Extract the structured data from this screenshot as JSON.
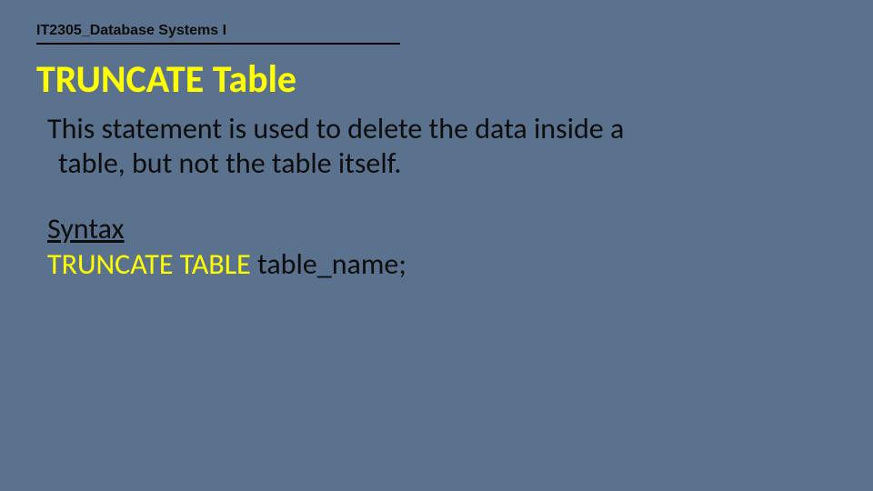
{
  "course": "IT2305_Database Systems I",
  "title": "TRUNCATE Table",
  "description": "This statement is used to delete the data inside a table, but not the table itself.",
  "syntax_label": "Syntax",
  "syntax_keyword": "TRUNCATE TABLE ",
  "syntax_argument": "table_name;"
}
